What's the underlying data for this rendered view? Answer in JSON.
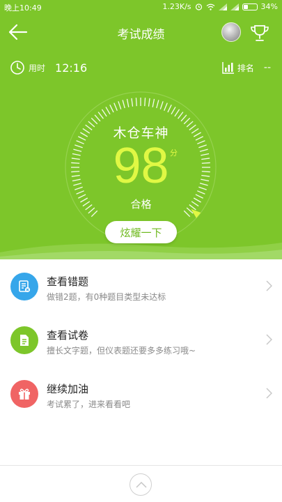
{
  "status_bar": {
    "time": "晚上10:49",
    "network_speed": "1.23K/s",
    "battery": "34%",
    "icons": [
      "alarm-icon",
      "wifi-icon",
      "signal-icon",
      "signal-icon",
      "battery-icon"
    ]
  },
  "header": {
    "title": "考试成绩",
    "left_icon": "back-arrow-icon",
    "right_icons": [
      "avatar",
      "trophy-icon"
    ]
  },
  "stats": {
    "time_label": "用时",
    "time_value": "12:16",
    "rank_label": "排名",
    "rank_value": "--"
  },
  "result": {
    "rank_title": "木仓车神",
    "score": "98",
    "score_unit": "分",
    "score_max": 100,
    "verdict": "合格",
    "share_label": "炫耀一下"
  },
  "menu": [
    {
      "title": "查看错题",
      "subtitle": "做错2题，有0种题目类型未达标",
      "icon": "wrong-questions-icon",
      "color": "#36a6ea"
    },
    {
      "title": "查看试卷",
      "subtitle": "擅长文字题，但仪表题还要多多练习哦~",
      "icon": "paper-icon",
      "color": "#7dc62a"
    },
    {
      "title": "继续加油",
      "subtitle": "考试累了，进来看看吧",
      "icon": "gift-icon",
      "color": "#f06464"
    }
  ],
  "footer": {
    "icon": "chevron-up-icon"
  },
  "colors": {
    "brand_green": "#7dc62a",
    "score_yellow": "#e0f844",
    "text_dark": "#222222",
    "text_gray": "#8a8a8a"
  }
}
